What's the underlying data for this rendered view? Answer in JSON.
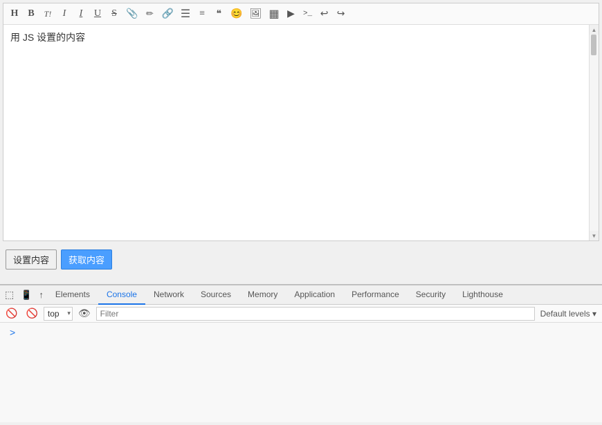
{
  "editor": {
    "content": "用 JS 设置的内容",
    "toolbar": {
      "buttons": [
        {
          "id": "heading",
          "label": "H",
          "title": "Heading"
        },
        {
          "id": "bold",
          "label": "B",
          "title": "Bold"
        },
        {
          "id": "italic2",
          "label": "T!",
          "title": "Italic2"
        },
        {
          "id": "italic",
          "label": "I",
          "title": "Italic"
        },
        {
          "id": "italic3",
          "label": "I",
          "title": "Italic3"
        },
        {
          "id": "underline",
          "label": "U",
          "title": "Underline"
        },
        {
          "id": "strikethrough",
          "label": "S̶",
          "title": "Strikethrough"
        },
        {
          "id": "attach",
          "label": "📎",
          "title": "Attach"
        },
        {
          "id": "highlight",
          "label": "🖊",
          "title": "Highlight"
        },
        {
          "id": "link",
          "label": "🔗",
          "title": "Link"
        },
        {
          "id": "list-unordered",
          "label": "≡",
          "title": "Unordered List"
        },
        {
          "id": "list-ordered",
          "label": "≣",
          "title": "Ordered List"
        },
        {
          "id": "blockquote",
          "label": "❝",
          "title": "Blockquote"
        },
        {
          "id": "emoji",
          "label": "😊",
          "title": "Emoji"
        },
        {
          "id": "image",
          "label": "🖼",
          "title": "Image"
        },
        {
          "id": "table",
          "label": "▦",
          "title": "Table"
        },
        {
          "id": "video",
          "label": "▶",
          "title": "Video"
        },
        {
          "id": "code",
          "label": ">_",
          "title": "Code"
        },
        {
          "id": "undo",
          "label": "↩",
          "title": "Undo"
        },
        {
          "id": "redo",
          "label": "↪",
          "title": "Redo"
        }
      ]
    }
  },
  "buttons": {
    "set_content": "设置内容",
    "get_content": "获取内容"
  },
  "devtools": {
    "tabs": [
      {
        "id": "elements",
        "label": "Elements",
        "active": false
      },
      {
        "id": "console",
        "label": "Console",
        "active": true
      },
      {
        "id": "network",
        "label": "Network",
        "active": false
      },
      {
        "id": "sources",
        "label": "Sources",
        "active": false
      },
      {
        "id": "memory",
        "label": "Memory",
        "active": false
      },
      {
        "id": "application",
        "label": "Application",
        "active": false
      },
      {
        "id": "performance",
        "label": "Performance",
        "active": false
      },
      {
        "id": "security",
        "label": "Security",
        "active": false
      },
      {
        "id": "lighthouse",
        "label": "Lighthouse",
        "active": false
      }
    ],
    "console_toolbar": {
      "top_select_value": "top",
      "top_select_arrow": "▾",
      "filter_placeholder": "Filter",
      "default_levels": "Default levels ▾"
    }
  }
}
